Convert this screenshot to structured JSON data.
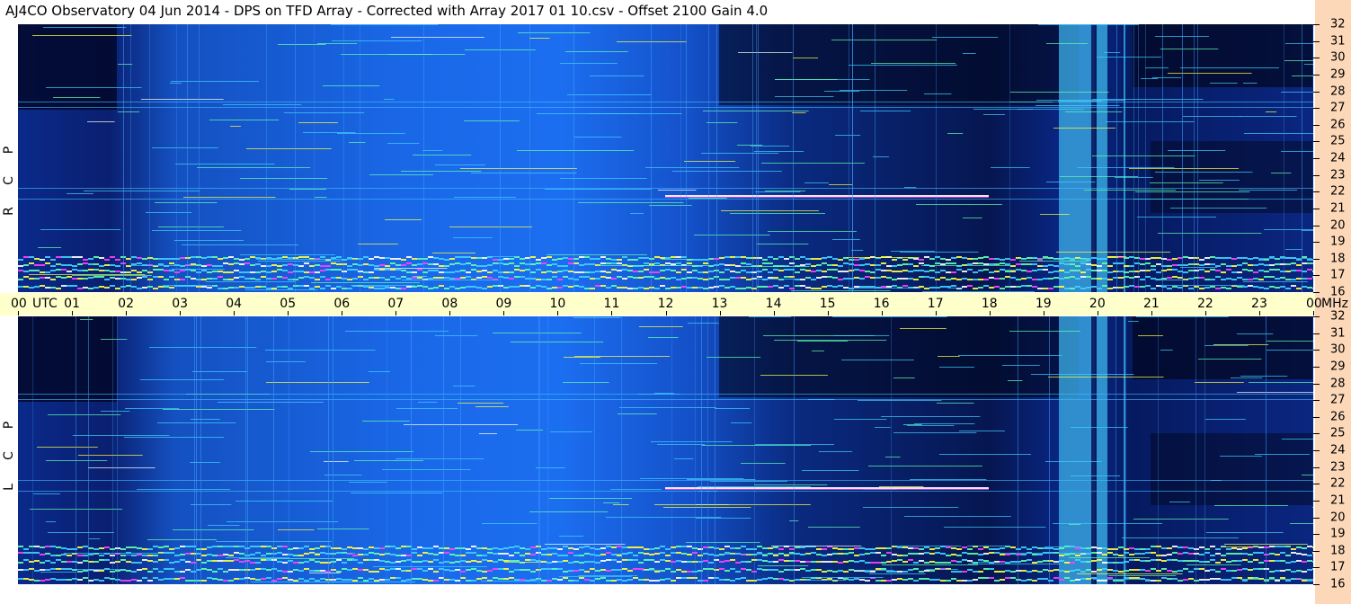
{
  "title": "AJ4CO Observatory  04 Jun 2014  -  DPS on TFD Array  -  Corrected with Array 2017 01 10.csv  -  Offset 2100  Gain 4.0",
  "panels": [
    {
      "id": "rcp",
      "label": [
        "R",
        "C",
        "P"
      ]
    },
    {
      "id": "lcp",
      "label": [
        "L",
        "C",
        "P"
      ]
    }
  ],
  "chart_data": {
    "type": "heatmap",
    "title": "AJ4CO Observatory  04 Jun 2014  -  DPS on TFD Array  -  Corrected with Array 2017 01 10.csv  -  Offset 2100  Gain 4.0",
    "xlabel": "UTC",
    "ylabel": "MHz",
    "x_ticks": [
      "00",
      "01",
      "02",
      "03",
      "04",
      "05",
      "06",
      "07",
      "08",
      "09",
      "10",
      "11",
      "12",
      "13",
      "14",
      "15",
      "16",
      "17",
      "18",
      "19",
      "20",
      "21",
      "22",
      "23",
      "00"
    ],
    "x_range": [
      0,
      24
    ],
    "y_ticks": [
      16,
      17,
      18,
      19,
      20,
      21,
      22,
      23,
      24,
      25,
      26,
      27,
      28,
      29,
      30,
      31,
      32
    ],
    "y_range": [
      16,
      32
    ],
    "series": [
      {
        "name": "RCP"
      },
      {
        "name": "LCP"
      }
    ],
    "colormap": [
      "#000c3a",
      "#0a2a9a",
      "#1a5ad8",
      "#3aa0ff",
      "#40d0ff",
      "#60ffb0",
      "#ffff40",
      "#ff40ff",
      "#ffffff"
    ]
  },
  "time_axis": {
    "first_label": "00",
    "utc_label": "UTC",
    "last_label": "00",
    "unit": "MHz"
  }
}
